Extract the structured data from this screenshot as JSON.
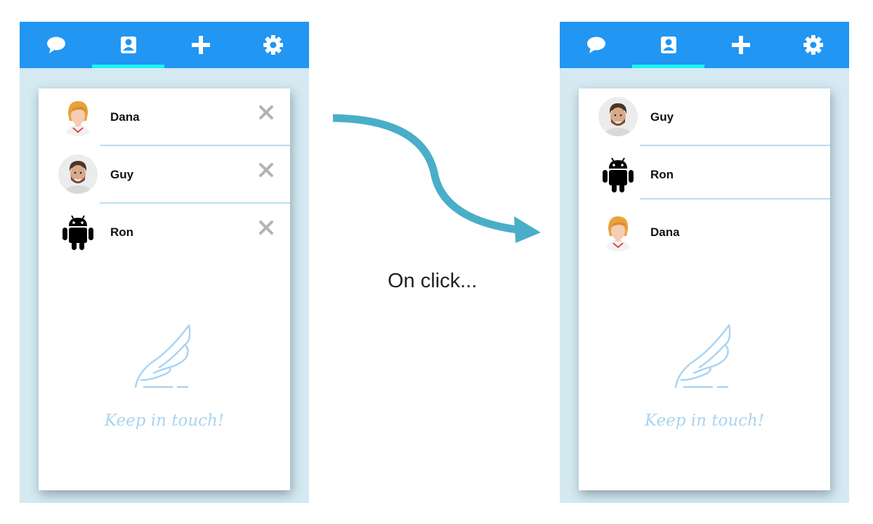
{
  "tabs": [
    {
      "icon": "chat-bubble-icon",
      "selected": false
    },
    {
      "icon": "contact-card-icon",
      "selected": true
    },
    {
      "icon": "plus-icon",
      "selected": false
    },
    {
      "icon": "gear-icon",
      "selected": false
    }
  ],
  "before": {
    "contacts": [
      {
        "name": "Dana",
        "avatar": "woman-photo"
      },
      {
        "name": "Guy",
        "avatar": "man-photo"
      },
      {
        "name": "Ron",
        "avatar": "android-robot-icon"
      }
    ]
  },
  "after": {
    "contacts": [
      {
        "name": "Guy",
        "avatar": "man-photo"
      },
      {
        "name": "Ron",
        "avatar": "android-robot-icon"
      },
      {
        "name": "Dana",
        "avatar": "woman-photo"
      }
    ]
  },
  "empty_state": {
    "tagline": "Keep in touch!",
    "icon": "wing-icon"
  },
  "caption": "On click...",
  "colors": {
    "topbar": "#2196f3",
    "tab_indicator": "#18f5f5",
    "panel_background": "#d4e9f1",
    "divider": "#b9dcf2",
    "arrow": "#4aaec8",
    "tagline": "#aad4f0"
  }
}
